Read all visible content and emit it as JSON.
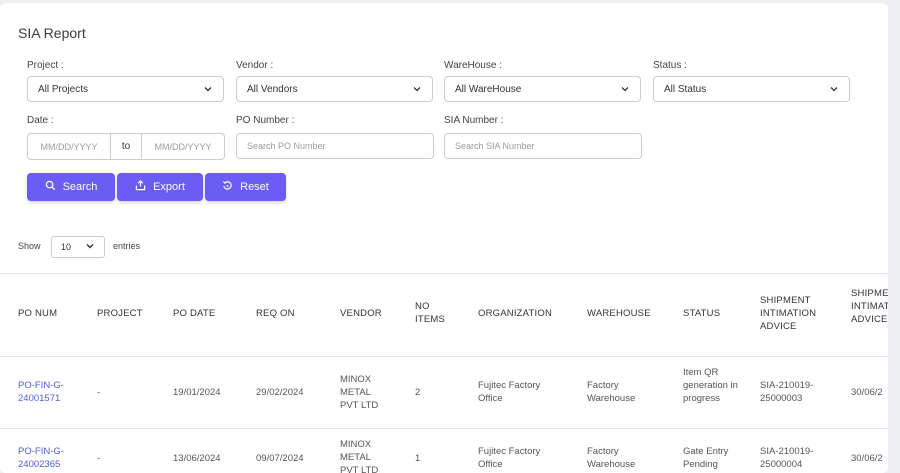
{
  "page": {
    "title": "SIA Report"
  },
  "filters": {
    "project": {
      "label": "Project :",
      "value": "All Projects"
    },
    "vendor": {
      "label": "Vendor :",
      "value": "All Vendors"
    },
    "warehouse": {
      "label": "WareHouse :",
      "value": "All WareHouse"
    },
    "status": {
      "label": "Status :",
      "value": "All Status"
    },
    "date": {
      "label": "Date :",
      "from_placeholder": "MM/DD/YYYY",
      "to_label": "to",
      "to_placeholder": "MM/DD/YYYY"
    },
    "po_number": {
      "label": "PO Number :",
      "placeholder": "Search PO Number"
    },
    "sia_number": {
      "label": "SIA Number :",
      "placeholder": "Search SIA Number"
    }
  },
  "buttons": {
    "search": "Search",
    "export": "Export",
    "reset": "Reset"
  },
  "colors": {
    "accent": "#6a5cf5",
    "link": "#4e5ed6"
  },
  "length": {
    "show": "Show",
    "value": "10",
    "entries": "entries"
  },
  "table": {
    "headers": [
      "PO NUM",
      "PROJECT",
      "PO DATE",
      "REQ ON",
      "VENDOR",
      "NO ITEMS",
      "ORGANIZATION",
      "WAREHOUSE",
      "STATUS",
      "SHIPMENT INTIMATION ADVICE",
      "SHIPMENT INTIMATION ADVICE DATE"
    ],
    "rows": [
      {
        "po_num": "PO-FIN-G-24001571",
        "project": "-",
        "po_date": "19/01/2024",
        "req_on": "29/02/2024",
        "vendor": "MINOX METAL PVT LTD",
        "no_items": "2",
        "organization": "Fujitec Factory Office",
        "warehouse": "Factory Warehouse",
        "status": "Item QR generation in progress",
        "sia": "SIA-210019-25000003",
        "sia_date": "30/06/2"
      },
      {
        "po_num": "PO-FIN-G-24002365",
        "project": "-",
        "po_date": "13/06/2024",
        "req_on": "09/07/2024",
        "vendor": "MINOX METAL PVT LTD",
        "no_items": "1",
        "organization": "Fujitec Factory Office",
        "warehouse": "Factory Warehouse",
        "status": "Gate Entry Pending",
        "sia": "SIA-210019-25000004",
        "sia_date": "30/06/2"
      }
    ]
  }
}
